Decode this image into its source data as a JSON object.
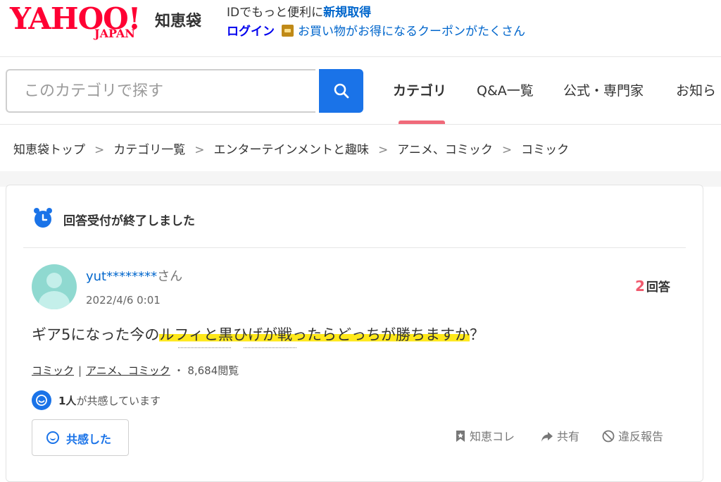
{
  "header": {
    "logo_yahoo": "YAHOO!",
    "logo_japan": "JAPAN",
    "service_name": "知恵袋",
    "id_promo_text": "IDでもっと便利に",
    "register_link": "新規取得",
    "login_link": "ログイン",
    "coupon_text": "お買い物がお得になるクーポンがたくさん"
  },
  "search": {
    "placeholder": "このカテゴリで探す"
  },
  "nav": {
    "items": [
      {
        "label": "カテゴリ",
        "active": true
      },
      {
        "label": "Q&A一覧",
        "active": false
      },
      {
        "label": "公式・専門家",
        "active": false
      },
      {
        "label": "お知ら",
        "active": false
      }
    ]
  },
  "breadcrumb": {
    "items": [
      "知恵袋トップ",
      "カテゴリ一覧",
      "エンターテインメントと趣味",
      "アニメ、コミック",
      "コミック"
    ],
    "separator": ">"
  },
  "question": {
    "status": "回答受付が終了しました",
    "user": "yut********",
    "user_suffix": "さん",
    "date": "2022/4/6 0:01",
    "answer_count": "2",
    "answer_label": "回答",
    "text_before": "ギア5になった今の",
    "text_highlight": "ルフィと黒ひげが戦ったらどっちが勝ちますか",
    "text_after": "？",
    "categories": [
      "コミック",
      "アニメ、コミック"
    ],
    "views": "8,684閲覧",
    "empathy_count": "1人",
    "empathy_text": "が共感しています",
    "empathy_button": "共感した",
    "actions": [
      "知恵コレ",
      "共有",
      "違反報告"
    ]
  },
  "colors": {
    "brand_red": "#ff0033",
    "link_blue": "#0066cc",
    "accent_blue": "#1a73e8",
    "highlight_yellow": "#ffe81a",
    "answer_pink": "#f05a6e"
  }
}
